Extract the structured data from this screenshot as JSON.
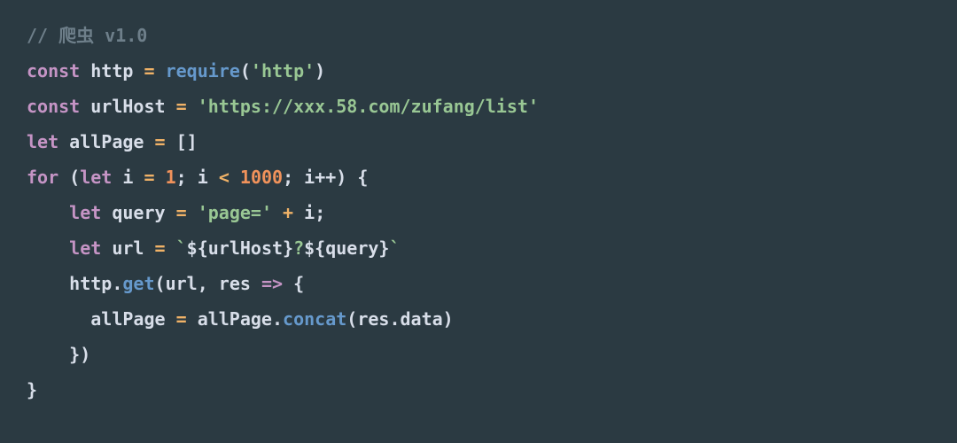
{
  "code": {
    "commentPrefix": "// ",
    "commentText": "爬虫 v1.0",
    "kwConst1": "const",
    "idHttp": "http",
    "fnRequire": "require",
    "strHttpMod": "'http'",
    "kwConst2": "const",
    "idUrlHost": "urlHost",
    "strUrlHost": "'https://xxx.58.com/zufang/list'",
    "kwLet1": "let",
    "idAllPage": "allPage",
    "arrEmpty": "[]",
    "kwFor": "for",
    "kwLet2": "let",
    "idI": "i",
    "num1": "1",
    "num1000": "1000",
    "incI": "i++",
    "kwLet3": "let",
    "idQuery": "query",
    "strPage": "'page='",
    "plus": "+",
    "idI2": "i",
    "kwLet4": "let",
    "idUrl": "url",
    "tplOpen": "`",
    "tplUrlHost": "${urlHost}",
    "tplQ": "?",
    "tplQuery": "${query}",
    "tplClose": "`",
    "idHttp2": "http",
    "fnGet": "get",
    "idUrl2": "url",
    "idRes": "res",
    "arrow": "=>",
    "idAllPage2": "allPage",
    "idAllPage3": "allPage",
    "fnConcat": "concat",
    "idResData": "res.data",
    "eq": "=",
    "lt": "<",
    "semi": ";",
    "comma": ", ",
    "lparen": "(",
    "rparen": ")",
    "lbrace": "{",
    "rbrace": "}",
    "dot": "."
  }
}
